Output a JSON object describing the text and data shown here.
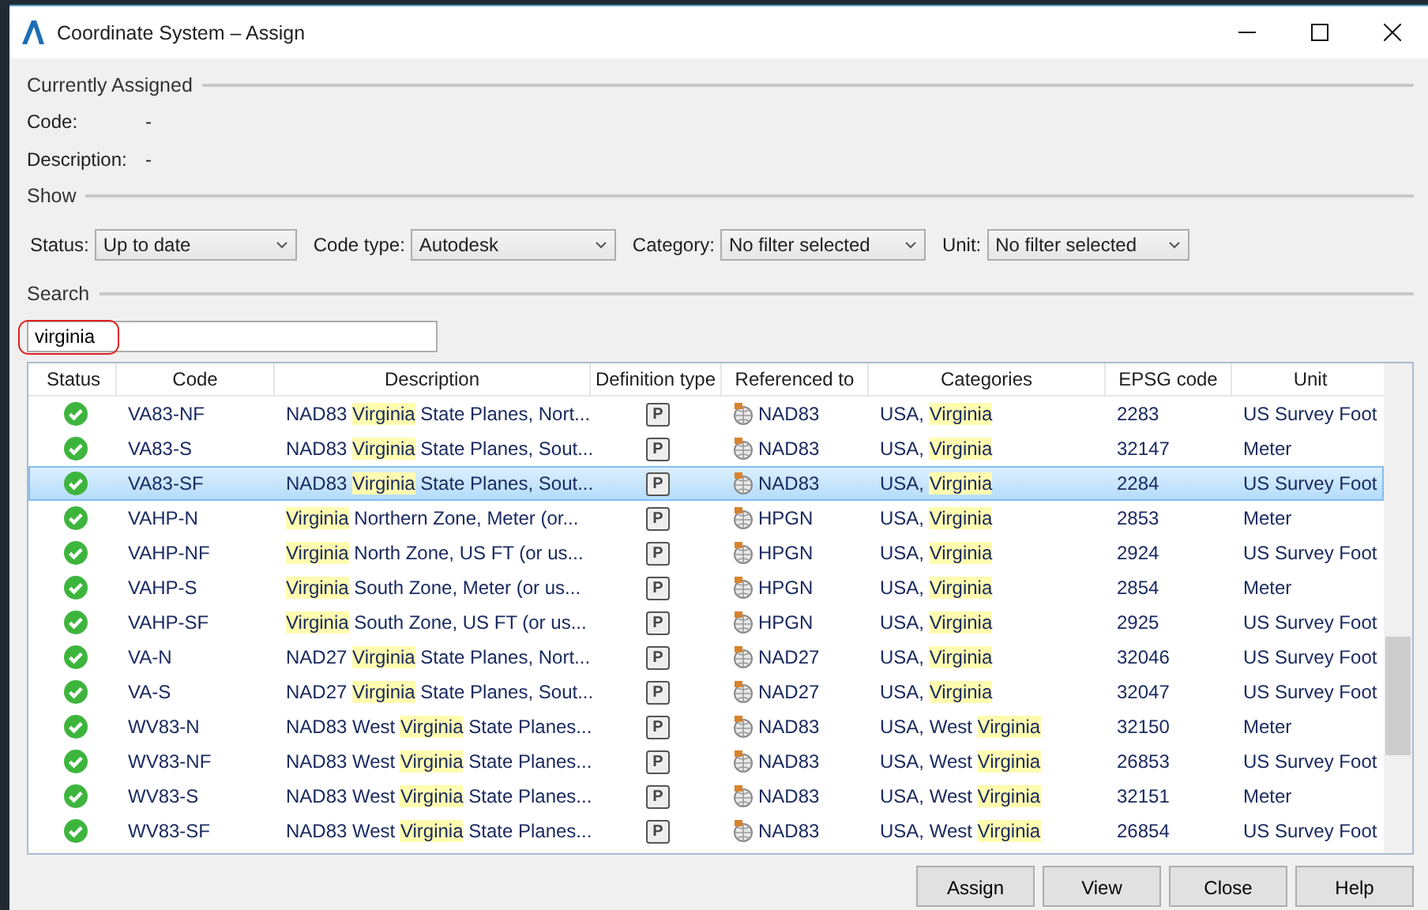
{
  "window": {
    "title": "Coordinate System – Assign"
  },
  "currently_assigned": {
    "heading": "Currently Assigned",
    "fields": [
      {
        "label": "Code:",
        "value": "-"
      },
      {
        "label": "Description:",
        "value": "-"
      }
    ]
  },
  "show": {
    "heading": "Show",
    "filters": [
      {
        "label": "Status:",
        "value": "Up to date"
      },
      {
        "label": "Code type:",
        "value": "Autodesk"
      },
      {
        "label": "Category:",
        "value": "No filter selected"
      },
      {
        "label": "Unit:",
        "value": "No filter selected"
      }
    ]
  },
  "search": {
    "heading": "Search",
    "value": "virginia"
  },
  "table": {
    "columns": [
      "Status",
      "Code",
      "Description",
      "Definition type",
      "Referenced to",
      "Categories",
      "EPSG code",
      "Unit"
    ],
    "rows": [
      {
        "selected": false,
        "code": "VA83-NF",
        "description": [
          {
            "text": "NAD83 ",
            "match": false
          },
          {
            "text": "Virginia",
            "match": true
          },
          {
            "text": " State Planes, Nort...",
            "match": false
          }
        ],
        "definition_type": "P",
        "referenced_to": "NAD83",
        "categories": [
          {
            "text": "USA, ",
            "match": false
          },
          {
            "text": "Virginia",
            "match": true
          }
        ],
        "epsg": "2283",
        "unit": "US Survey Foot"
      },
      {
        "selected": false,
        "code": "VA83-S",
        "description": [
          {
            "text": "NAD83 ",
            "match": false
          },
          {
            "text": "Virginia",
            "match": true
          },
          {
            "text": " State Planes, Sout...",
            "match": false
          }
        ],
        "definition_type": "P",
        "referenced_to": "NAD83",
        "categories": [
          {
            "text": "USA, ",
            "match": false
          },
          {
            "text": "Virginia",
            "match": true
          }
        ],
        "epsg": "32147",
        "unit": "Meter"
      },
      {
        "selected": true,
        "code": "VA83-SF",
        "description": [
          {
            "text": "NAD83 ",
            "match": false
          },
          {
            "text": "Virginia",
            "match": true
          },
          {
            "text": " State Planes, Sout...",
            "match": false
          }
        ],
        "definition_type": "P",
        "referenced_to": "NAD83",
        "categories": [
          {
            "text": "USA, ",
            "match": false
          },
          {
            "text": "Virginia",
            "match": true
          }
        ],
        "epsg": "2284",
        "unit": "US Survey Foot"
      },
      {
        "selected": false,
        "code": "VAHP-N",
        "description": [
          {
            "text": "Virginia",
            "match": true
          },
          {
            "text": " Northern Zone, Meter (or...",
            "match": false
          }
        ],
        "definition_type": "P",
        "referenced_to": "HPGN",
        "categories": [
          {
            "text": "USA, ",
            "match": false
          },
          {
            "text": "Virginia",
            "match": true
          }
        ],
        "epsg": "2853",
        "unit": "Meter"
      },
      {
        "selected": false,
        "code": "VAHP-NF",
        "description": [
          {
            "text": "Virginia",
            "match": true
          },
          {
            "text": " North Zone, US FT (or us...",
            "match": false
          }
        ],
        "definition_type": "P",
        "referenced_to": "HPGN",
        "categories": [
          {
            "text": "USA, ",
            "match": false
          },
          {
            "text": "Virginia",
            "match": true
          }
        ],
        "epsg": "2924",
        "unit": "US Survey Foot"
      },
      {
        "selected": false,
        "code": "VAHP-S",
        "description": [
          {
            "text": "Virginia",
            "match": true
          },
          {
            "text": " South Zone, Meter (or us...",
            "match": false
          }
        ],
        "definition_type": "P",
        "referenced_to": "HPGN",
        "categories": [
          {
            "text": "USA, ",
            "match": false
          },
          {
            "text": "Virginia",
            "match": true
          }
        ],
        "epsg": "2854",
        "unit": "Meter"
      },
      {
        "selected": false,
        "code": "VAHP-SF",
        "description": [
          {
            "text": "Virginia",
            "match": true
          },
          {
            "text": " South Zone, US FT (or us...",
            "match": false
          }
        ],
        "definition_type": "P",
        "referenced_to": "HPGN",
        "categories": [
          {
            "text": "USA, ",
            "match": false
          },
          {
            "text": "Virginia",
            "match": true
          }
        ],
        "epsg": "2925",
        "unit": "US Survey Foot"
      },
      {
        "selected": false,
        "code": "VA-N",
        "description": [
          {
            "text": "NAD27 ",
            "match": false
          },
          {
            "text": "Virginia",
            "match": true
          },
          {
            "text": " State Planes, Nort...",
            "match": false
          }
        ],
        "definition_type": "P",
        "referenced_to": "NAD27",
        "categories": [
          {
            "text": "USA, ",
            "match": false
          },
          {
            "text": "Virginia",
            "match": true
          }
        ],
        "epsg": "32046",
        "unit": "US Survey Foot"
      },
      {
        "selected": false,
        "code": "VA-S",
        "description": [
          {
            "text": "NAD27 ",
            "match": false
          },
          {
            "text": "Virginia",
            "match": true
          },
          {
            "text": " State Planes, Sout...",
            "match": false
          }
        ],
        "definition_type": "P",
        "referenced_to": "NAD27",
        "categories": [
          {
            "text": "USA, ",
            "match": false
          },
          {
            "text": "Virginia",
            "match": true
          }
        ],
        "epsg": "32047",
        "unit": "US Survey Foot"
      },
      {
        "selected": false,
        "code": "WV83-N",
        "description": [
          {
            "text": "NAD83 West ",
            "match": false
          },
          {
            "text": "Virginia",
            "match": true
          },
          {
            "text": " State Planes...",
            "match": false
          }
        ],
        "definition_type": "P",
        "referenced_to": "NAD83",
        "categories": [
          {
            "text": "USA, West ",
            "match": false
          },
          {
            "text": "Virginia",
            "match": true
          }
        ],
        "epsg": "32150",
        "unit": "Meter"
      },
      {
        "selected": false,
        "code": "WV83-NF",
        "description": [
          {
            "text": "NAD83 West ",
            "match": false
          },
          {
            "text": "Virginia",
            "match": true
          },
          {
            "text": " State Planes...",
            "match": false
          }
        ],
        "definition_type": "P",
        "referenced_to": "NAD83",
        "categories": [
          {
            "text": "USA, West ",
            "match": false
          },
          {
            "text": "Virginia",
            "match": true
          }
        ],
        "epsg": "26853",
        "unit": "US Survey Foot"
      },
      {
        "selected": false,
        "code": "WV83-S",
        "description": [
          {
            "text": "NAD83 West ",
            "match": false
          },
          {
            "text": "Virginia",
            "match": true
          },
          {
            "text": " State Planes...",
            "match": false
          }
        ],
        "definition_type": "P",
        "referenced_to": "NAD83",
        "categories": [
          {
            "text": "USA, West ",
            "match": false
          },
          {
            "text": "Virginia",
            "match": true
          }
        ],
        "epsg": "32151",
        "unit": "Meter"
      },
      {
        "selected": false,
        "code": "WV83-SF",
        "description": [
          {
            "text": "NAD83 West ",
            "match": false
          },
          {
            "text": "Virginia",
            "match": true
          },
          {
            "text": " State Planes...",
            "match": false
          }
        ],
        "definition_type": "P",
        "referenced_to": "NAD83",
        "categories": [
          {
            "text": "USA, West ",
            "match": false
          },
          {
            "text": "Virginia",
            "match": true
          }
        ],
        "epsg": "26854",
        "unit": "US Survey Foot"
      }
    ]
  },
  "buttons": [
    "Assign",
    "View",
    "Close",
    "Help"
  ]
}
